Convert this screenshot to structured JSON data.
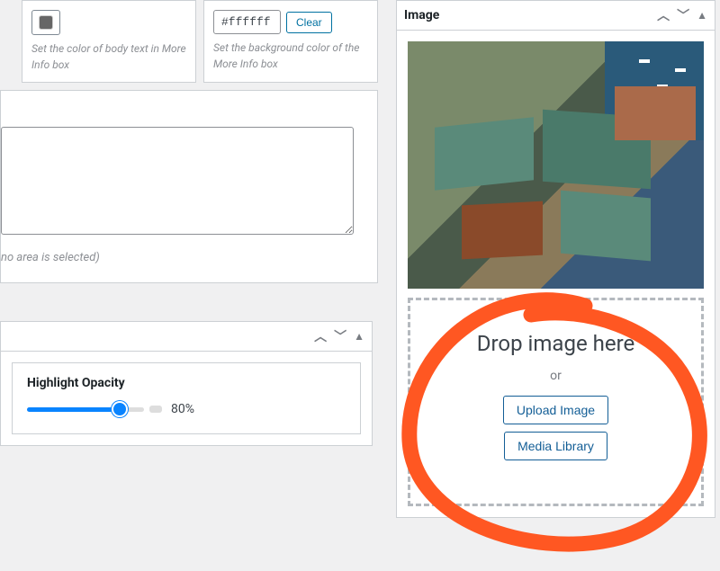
{
  "left": {
    "box1": {
      "desc": "Set the color of body text in More Info box"
    },
    "box2": {
      "hex": "#ffffff",
      "clear": "Clear",
      "desc": "Set the background color of the More Info box"
    },
    "noarea": "no area is selected)",
    "highlight": {
      "label": "Highlight Opacity",
      "value": "80%"
    }
  },
  "image_panel": {
    "title": "Image",
    "drop": "Drop image here",
    "or": "or",
    "upload": "Upload Image",
    "media": "Media Library"
  }
}
